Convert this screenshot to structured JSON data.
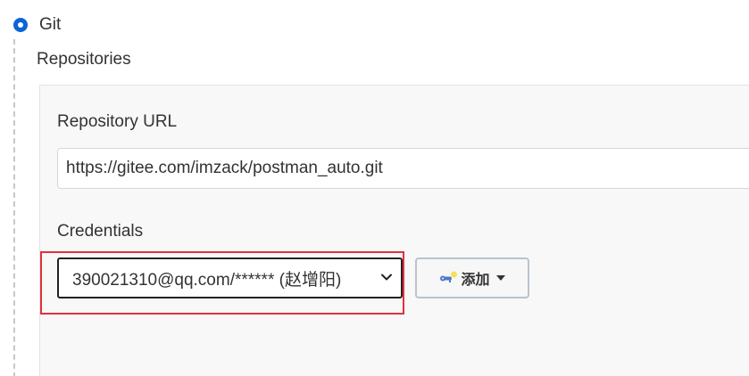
{
  "scm": {
    "option_label": "Git",
    "selected": true
  },
  "repositories": {
    "title": "Repositories",
    "url_label": "Repository URL",
    "url_value": "https://gitee.com/imzack/postman_auto.git",
    "credentials_label": "Credentials",
    "credentials_value": "390021310@qq.com/****** (赵增阳)",
    "add_button_label": "添加"
  },
  "colors": {
    "radio_accent": "#0b66d6",
    "highlight_border": "#e0323c"
  },
  "icons": {
    "add_button": "key-icon",
    "add_dropdown": "caret-down-icon",
    "select_dropdown": "chevron-down-icon"
  }
}
